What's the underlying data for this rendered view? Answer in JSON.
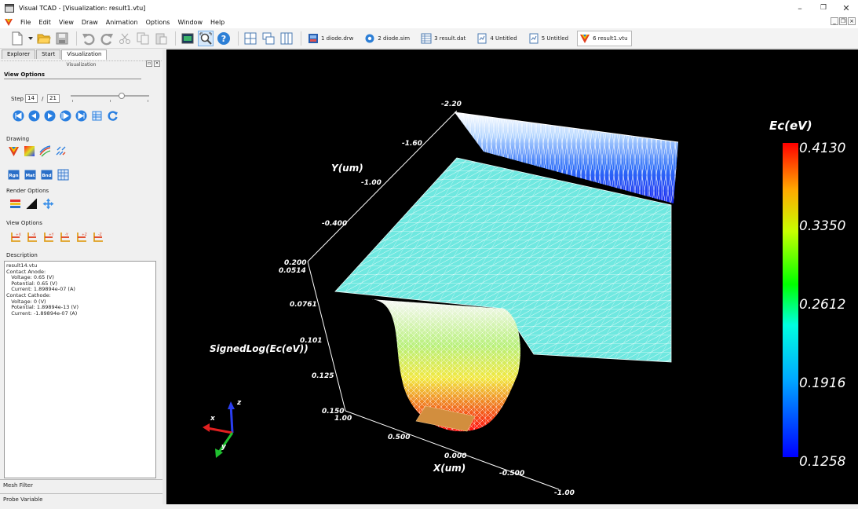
{
  "window": {
    "title": "Visual TCAD - [Visualization: result1.vtu]",
    "min": "–",
    "restore": "❐",
    "close": "✕"
  },
  "menu": [
    "File",
    "Edit",
    "View",
    "Draw",
    "Animation",
    "Options",
    "Window",
    "Help"
  ],
  "doc_tabs": [
    {
      "label": "1 diode.drw"
    },
    {
      "label": "2 diode.sim"
    },
    {
      "label": "3 result.dat"
    },
    {
      "label": "4 Untitled"
    },
    {
      "label": "5 Untitled"
    },
    {
      "label": "6 result1.vtu"
    }
  ],
  "left_panel": {
    "tabs": [
      "Explorer",
      "Start",
      "Visualization"
    ],
    "subtitle": "Visualization",
    "view_options_header": "View Options",
    "step_label": "Step",
    "step_value": "14",
    "step_sep": "/",
    "step_total": "21",
    "step_slider_fraction": 0.65,
    "drawing_label": "Drawing",
    "drawing_buttons": [
      "Rgn",
      "Mat",
      "Bnd"
    ],
    "render_label": "Render Options",
    "view_label": "View Options",
    "view_buttons": [
      "+X",
      "-X",
      "+Y",
      "-Y",
      "+Z",
      "-Z"
    ],
    "description_label": "Description",
    "description_lines": [
      "result14.vtu",
      "Contact Anode:",
      "   Voltage: 0.65 (V)",
      "   Potential: 0.65 (V)",
      "   Current: 1.89894e-07 (A)",
      "Contact Cathode:",
      "   Voltage: 0 (V)",
      "   Potential: 1.89894e-13 (V)",
      "   Current: -1.89894e-07 (A)"
    ],
    "mesh_filter": "Mesh Filter",
    "probe_variable": "Probe Variable"
  },
  "plot": {
    "y_axis_title": "Y(um)",
    "y_ticks": [
      "-2.20",
      "-1.60",
      "-1.00",
      "-0.400",
      "0.200"
    ],
    "z_axis_title": "SignedLog(Ec(eV))",
    "z_ticks": [
      "0.0514",
      "0.0761",
      "0.101",
      "0.125",
      "0.150"
    ],
    "x_axis_title": "X(um)",
    "x_ticks": [
      "1.00",
      "0.500",
      "0.000",
      "-0.500",
      "-1.00"
    ],
    "colorbar_title": "Ec(eV)",
    "colorbar_labels": [
      "0.4130",
      "0.3350",
      "0.2612",
      "0.1916",
      "0.1258"
    ],
    "colorbar_range": [
      0.1258,
      0.413
    ],
    "colors": {
      "low": "#0000ff",
      "mid": "#00ff00",
      "high": "#ff0000",
      "surface": "#6fe8e0"
    },
    "axes_triad": [
      "x",
      "y",
      "z"
    ]
  }
}
